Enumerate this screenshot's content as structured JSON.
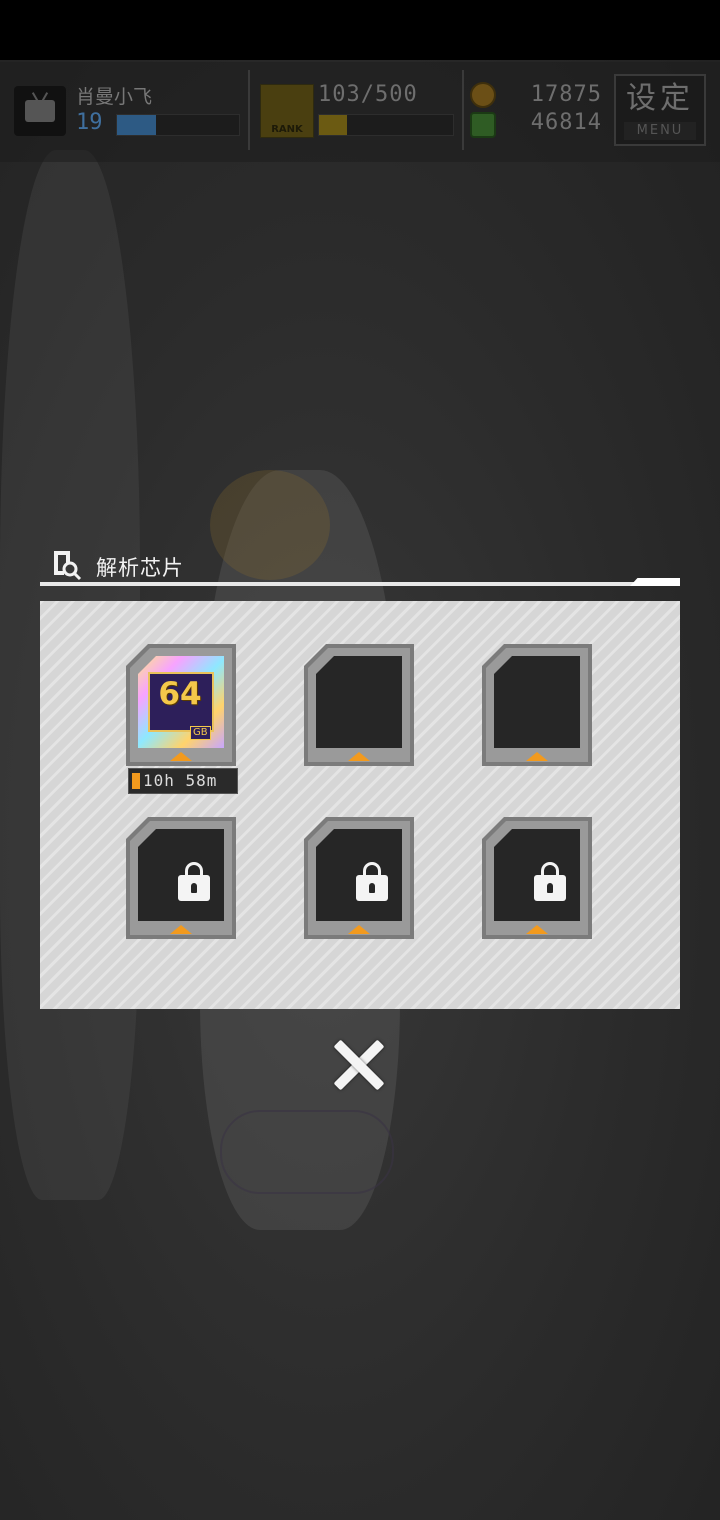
{
  "hud": {
    "username": "肖曼小飞",
    "level": "19",
    "exp_fraction": 0.32,
    "rank_icon_label": "RANK",
    "rank_progress_text": "103/500",
    "rank_fraction": 0.206,
    "currency_gold": "17875",
    "currency_green": "46814",
    "menu_kanji": "设定",
    "menu_label": "MENU"
  },
  "modal": {
    "title": "解析芯片",
    "slots": [
      {
        "state": "chip",
        "chip_capacity": "64",
        "chip_unit": "GB",
        "timer": "10h 58m"
      },
      {
        "state": "empty"
      },
      {
        "state": "empty"
      },
      {
        "state": "locked"
      },
      {
        "state": "locked"
      },
      {
        "state": "locked"
      }
    ]
  },
  "colors": {
    "accent_orange": "#f29a1e",
    "panel_bg": "#d6d6d6",
    "exp_bar": "#2d5a84",
    "rank_bar": "#6b5a12"
  }
}
